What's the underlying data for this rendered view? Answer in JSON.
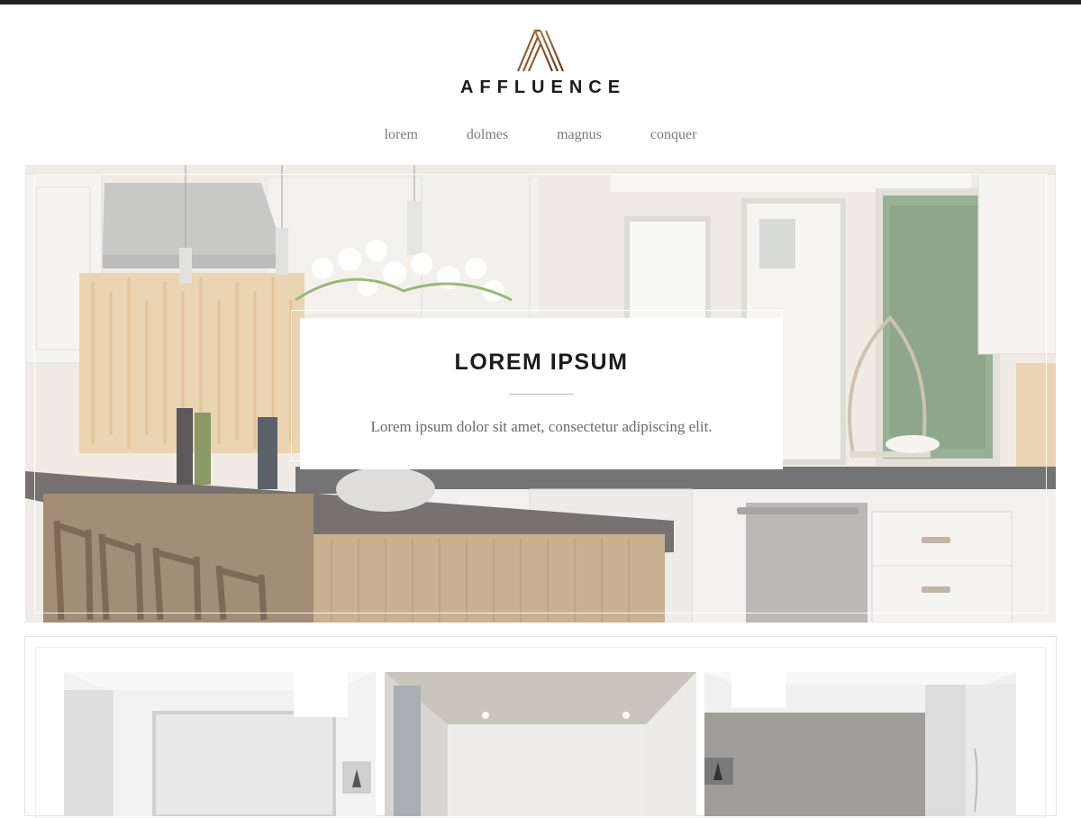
{
  "brand": {
    "name": "AFFLUENCE",
    "accent_color": "#8a5a32",
    "logo_icon": "letter-a-monogram-icon"
  },
  "nav": {
    "items": [
      {
        "label": "lorem"
      },
      {
        "label": "dolmes"
      },
      {
        "label": "magnus"
      },
      {
        "label": "conquer"
      }
    ]
  },
  "hero": {
    "title": "LOREM IPSUM",
    "subtitle": "Lorem ipsum dolor sit amet, consectetur adipiscing elit.",
    "image": "kitchen-photo"
  },
  "gallery": {
    "tiles": [
      {
        "image": "white-room-photo"
      },
      {
        "image": "hallway-room-photo"
      },
      {
        "image": "grey-room-photo"
      }
    ]
  }
}
